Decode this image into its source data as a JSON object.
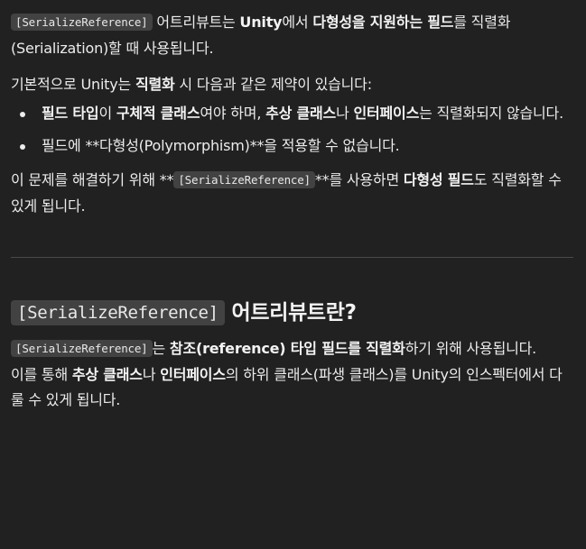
{
  "code_term": "[SerializeReference]",
  "para1": {
    "t1": " 어트리뷰트는 ",
    "b1": "Unity",
    "t2": "에서 ",
    "b2": "다형성을 지원하는 필드",
    "t3": "를 직렬화(Serialization)할 때 사용됩니다."
  },
  "para2": {
    "t1": "기본적으로 Unity는 ",
    "b1": "직렬화",
    "t2": " 시 다음과 같은 제약이 있습니다:"
  },
  "list": {
    "item1": {
      "b1": "필드 타입",
      "t1": "이 ",
      "b2": "구체적 클래스",
      "t2": "여야 하며, ",
      "b3": "추상 클래스",
      "t3": "나 ",
      "b4": "인터페이스",
      "t4": "는 직렬화되지 않습니다."
    },
    "item2": {
      "t1": "필드에 **다형성(Polymorphism)**을 적용할 수 없습니다."
    }
  },
  "para3": {
    "t1": "이 문제를 해결하기 위해 **",
    "t2": "**를 사용하면 ",
    "b1": "다형성 필드",
    "t3": "도 직렬화할 수 있게 됩니다."
  },
  "heading": {
    "text": " 어트리뷰트란?"
  },
  "para4": {
    "t1": "는 ",
    "b1": "참조(reference) 타입 필드를 직렬화",
    "t2": "하기 위해 사용됩니다."
  },
  "para5": {
    "t1": "이를 통해 ",
    "b1": "추상 클래스",
    "t2": "나 ",
    "b2": "인터페이스",
    "t3": "의 하위 클래스(파생 클래스)를 Unity의 인스펙터에서 다룰 수 있게 됩니다."
  }
}
